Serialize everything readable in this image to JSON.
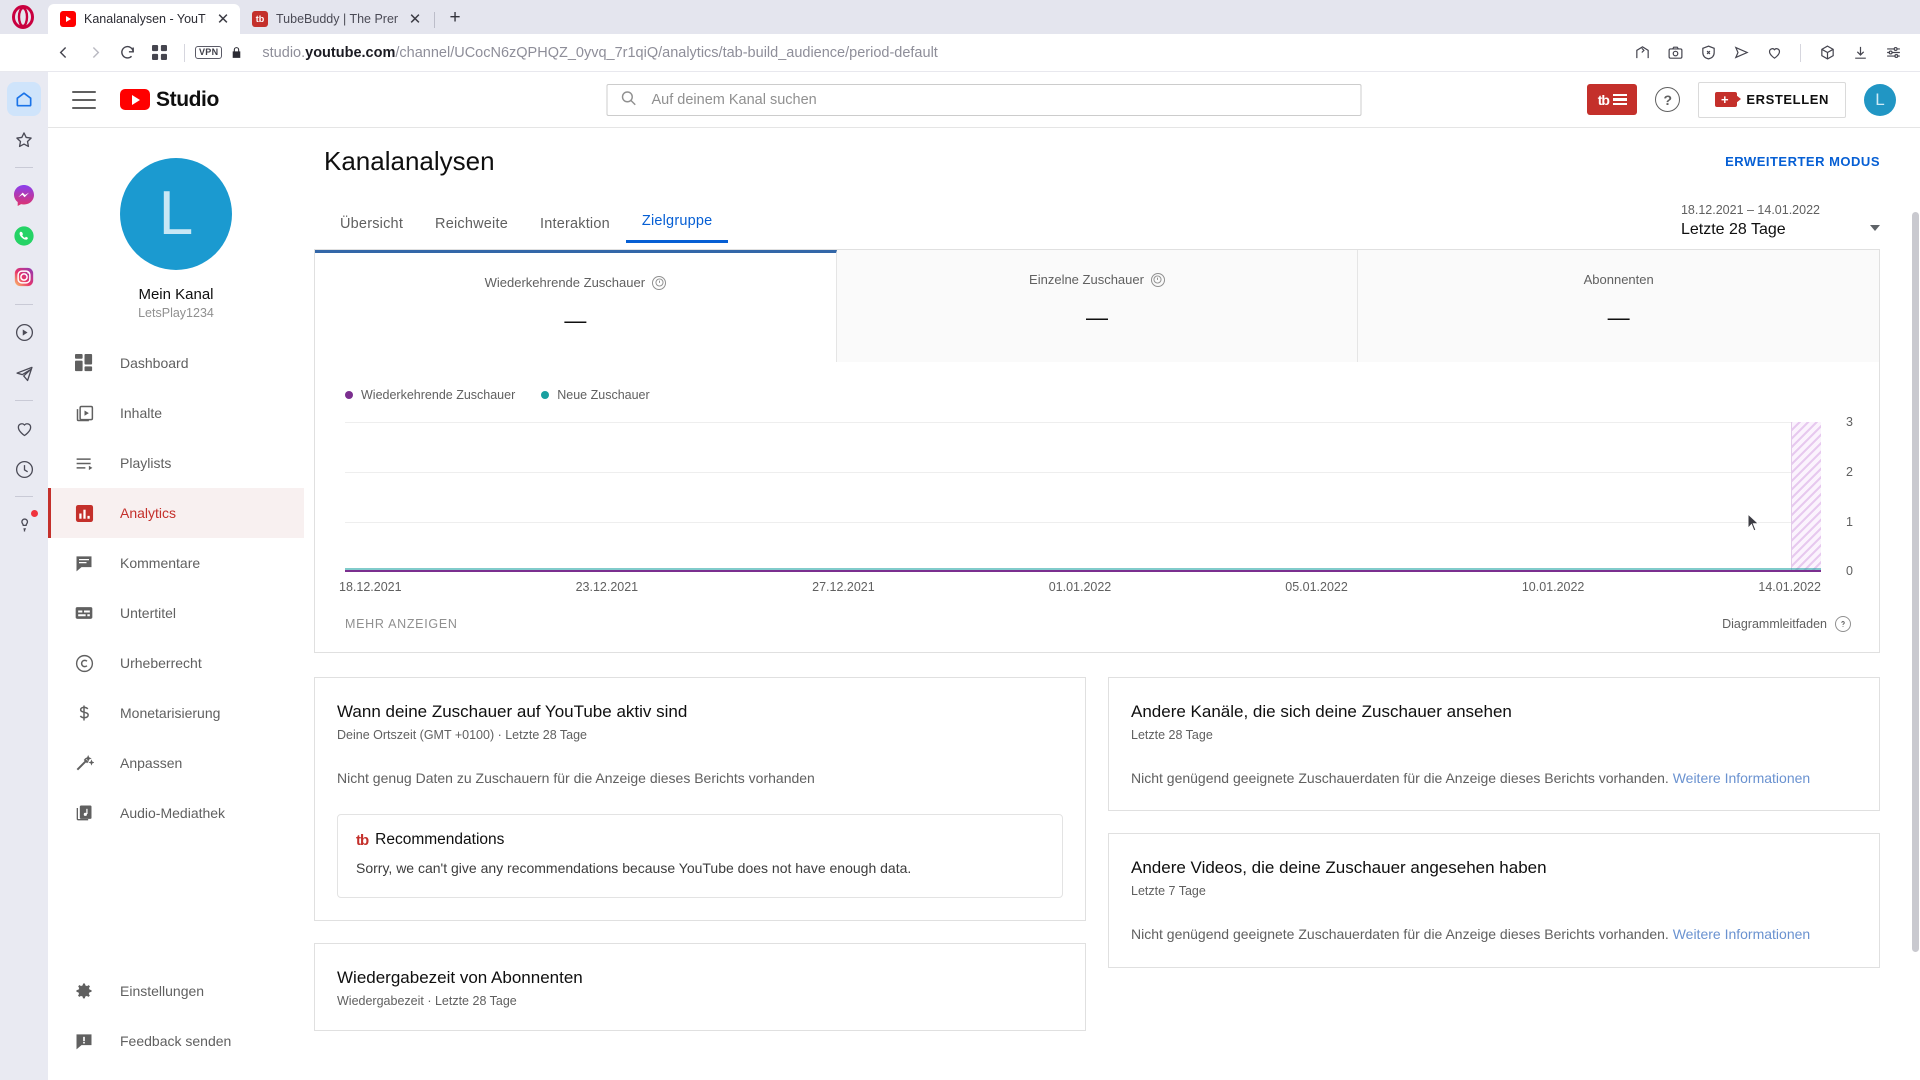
{
  "browser": {
    "tabs": [
      {
        "title": "Kanalanalysen - YouTube S",
        "favicon": "youtube-icon",
        "active": true
      },
      {
        "title": "TubeBuddy | The Premier Y",
        "favicon": "tubebuddy-icon",
        "active": false
      }
    ],
    "new_tab_label": "+",
    "close_label": "✕",
    "vpn_label": "VPN",
    "url_prefix": "studio.",
    "url_domain": "youtube.com",
    "url_path": "/channel/UCocN6zQPHQZ_0yvq_7r1qiQ/analytics/tab-build_audience/period-default",
    "nav_icons": [
      "back-icon",
      "forward-icon",
      "reload-icon",
      "speed-dial-icon"
    ],
    "toolbar_icons": [
      "pin-page-icon",
      "snapshot-icon",
      "ad-blocker-icon",
      "send-icon",
      "heart-icon",
      "cube-icon",
      "downloads-icon",
      "easy-setup-icon"
    ],
    "sidebar_icons": [
      "home-icon",
      "bookmarks-icon",
      "messenger-icon",
      "whatsapp-icon",
      "instagram-icon",
      "player-icon",
      "telegram-icon",
      "heart-icon",
      "history-icon",
      "tips-icon"
    ]
  },
  "header": {
    "menu_icon": "hamburger-icon",
    "brand": "Studio",
    "search": {
      "placeholder": "Auf deinem Kanal suchen",
      "icon": "search-icon",
      "value": ""
    },
    "tubebuddy_button": "tubebuddy-menu-icon",
    "help_icon": "?",
    "create_label": "ERSTELLEN",
    "avatar_initial": "L"
  },
  "sidebar": {
    "channel": {
      "avatar_initial": "L",
      "name": "Mein Kanal",
      "handle": "LetsPlay1234"
    },
    "items": [
      {
        "label": "Dashboard",
        "icon": "dashboard-icon",
        "active": false
      },
      {
        "label": "Inhalte",
        "icon": "content-icon",
        "active": false
      },
      {
        "label": "Playlists",
        "icon": "playlists-icon",
        "active": false
      },
      {
        "label": "Analytics",
        "icon": "analytics-icon",
        "active": true
      },
      {
        "label": "Kommentare",
        "icon": "comments-icon",
        "active": false
      },
      {
        "label": "Untertitel",
        "icon": "subtitles-icon",
        "active": false
      },
      {
        "label": "Urheberrecht",
        "icon": "copyright-icon",
        "active": false
      },
      {
        "label": "Monetarisierung",
        "icon": "dollar-icon",
        "active": false
      },
      {
        "label": "Anpassen",
        "icon": "wand-icon",
        "active": false
      },
      {
        "label": "Audio-Mediathek",
        "icon": "audio-library-icon",
        "active": false
      }
    ],
    "bottom_items": [
      {
        "label": "Einstellungen",
        "icon": "gear-icon"
      },
      {
        "label": "Feedback senden",
        "icon": "feedback-icon"
      }
    ]
  },
  "main": {
    "title": "Kanalanalysen",
    "advanced_mode": "ERWEITERTER MODUS",
    "tabs": [
      {
        "label": "Übersicht",
        "active": false
      },
      {
        "label": "Reichweite",
        "active": false
      },
      {
        "label": "Interaktion",
        "active": false
      },
      {
        "label": "Zielgruppe",
        "active": true
      }
    ],
    "date_range": {
      "dates": "18.12.2021 – 14.01.2022",
      "label": "Letzte 28 Tage"
    },
    "metrics": [
      {
        "title": "Wiederkehrende Zuschauer",
        "value": "—",
        "info": true,
        "selected": true
      },
      {
        "title": "Einzelne Zuschauer",
        "value": "—",
        "info": true,
        "selected": false
      },
      {
        "title": "Abonnenten",
        "value": "—",
        "info": false,
        "selected": false
      }
    ],
    "chart_footer": {
      "more": "MEHR ANZEIGEN",
      "guide": "Diagrammleitfaden"
    }
  },
  "chart_data": {
    "type": "line",
    "title": "Wiederkehrende Zuschauer / Neue Zuschauer",
    "xlabel": "",
    "ylabel": "",
    "ylim": [
      0,
      3
    ],
    "yticks": [
      3,
      2,
      1,
      0
    ],
    "grid": true,
    "legend_position": "top-left",
    "x_tick_labels": [
      "18.12.2021",
      "23.12.2021",
      "27.12.2021",
      "01.01.2022",
      "05.01.2022",
      "10.01.2022",
      "14.01.2022"
    ],
    "series": [
      {
        "name": "Wiederkehrende Zuschauer",
        "color": "#7b2f8f",
        "values": [
          0,
          0,
          0,
          0,
          0,
          0,
          0,
          0,
          0,
          0,
          0,
          0,
          0,
          0,
          0,
          0,
          0,
          0,
          0,
          0,
          0,
          0,
          0,
          0,
          0,
          0,
          0,
          0
        ]
      },
      {
        "name": "Neue Zuschauer",
        "color": "#19a0a0",
        "values": [
          0,
          0,
          0,
          0,
          0,
          0,
          0,
          0,
          0,
          0,
          0,
          0,
          0,
          0,
          0,
          0,
          0,
          0,
          0,
          0,
          0,
          0,
          0,
          0,
          0,
          0,
          0,
          0
        ]
      }
    ],
    "annotation": "hatched partial-data region at right edge (last day)"
  },
  "cards": {
    "active_times": {
      "title": "Wann deine Zuschauer auf YouTube aktiv sind",
      "subtitle": "Deine Ortszeit (GMT +0100) · Letzte 28 Tage",
      "message": "Nicht genug Daten zu Zuschauern für die Anzeige dieses Berichts vorhanden",
      "recommendation": {
        "heading": "Recommendations",
        "logo": "tubebuddy-icon",
        "text": "Sorry, we can't give any recommendations because YouTube does not have enough data."
      }
    },
    "watch_time_subs": {
      "title": "Wiedergabezeit von Abonnenten",
      "subtitle": "Wiedergabezeit · Letzte 28 Tage"
    },
    "other_channels": {
      "title": "Andere Kanäle, die sich deine Zuschauer ansehen",
      "subtitle": "Letzte 28 Tage",
      "message": "Nicht genügend geeignete Zuschauerdaten für die Anzeige dieses Berichts vorhanden.",
      "link": "Weitere Informationen"
    },
    "other_videos": {
      "title": "Andere Videos, die deine Zuschauer angesehen haben",
      "subtitle": "Letzte 7 Tage",
      "message": "Nicht genügend geeignete Zuschauerdaten für die Anzeige dieses Berichts vorhanden.",
      "link": "Weitere Informationen"
    }
  },
  "colors": {
    "youtube_red": "#ff0000",
    "tubebuddy_red": "#c4302b",
    "accent_blue": "#065fd4",
    "avatar_blue": "#1b9ad0",
    "series_purple": "#7b2f8f",
    "series_teal": "#19a0a0"
  }
}
